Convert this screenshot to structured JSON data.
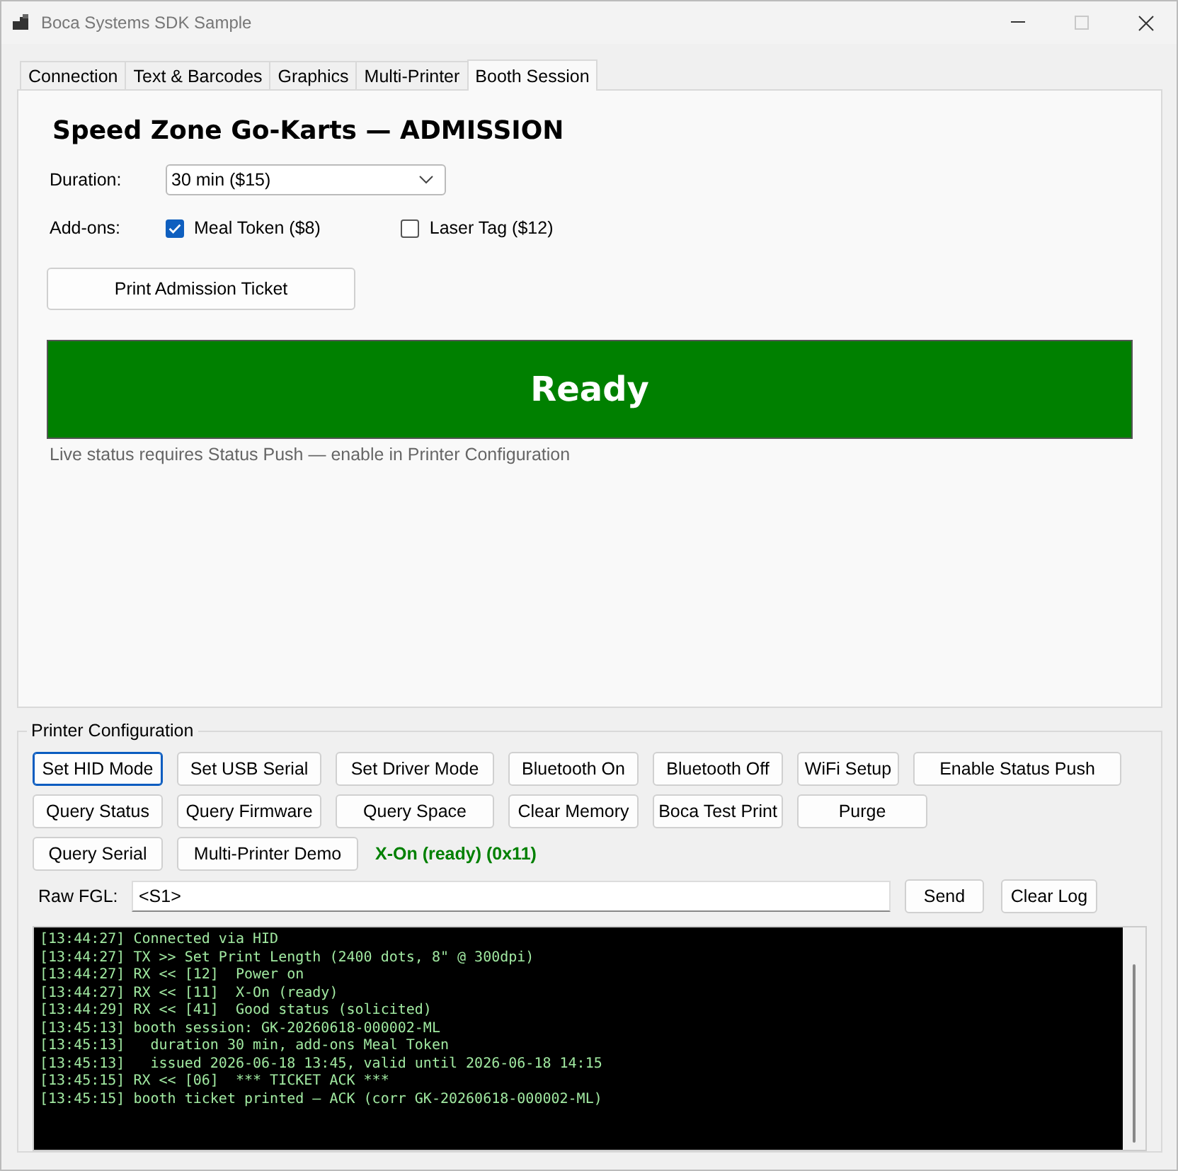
{
  "window": {
    "title": "Boca Systems SDK Sample",
    "maximize_disabled": true
  },
  "tabs": [
    {
      "label": "Connection",
      "selected": false
    },
    {
      "label": "Text & Barcodes",
      "selected": false
    },
    {
      "label": "Graphics",
      "selected": false
    },
    {
      "label": "Multi-Printer",
      "selected": false
    },
    {
      "label": "Booth Session",
      "selected": true
    }
  ],
  "booth": {
    "heading": "Speed Zone Go-Karts — ADMISSION",
    "duration": {
      "label": "Duration:",
      "value": "30 min ($15)"
    },
    "addons": {
      "label": "Add-ons:",
      "options": [
        {
          "label": "Meal Token ($8)",
          "checked": true
        },
        {
          "label": "Laser Tag ($12)",
          "checked": false
        }
      ]
    },
    "print_button": "Print Admission Ticket",
    "status": {
      "kind": "ready",
      "text": "Ready"
    },
    "note": "Live status requires Status Push — enable in Printer Configuration"
  },
  "config": {
    "title": "Printer Configuration",
    "button_rows": [
      [
        {
          "label": "Set HID Mode",
          "focused": true
        },
        {
          "label": "Set USB Serial",
          "focused": false
        },
        {
          "label": "Set Driver Mode",
          "focused": false
        },
        {
          "label": "Bluetooth On",
          "focused": false
        },
        {
          "label": "Bluetooth Off",
          "focused": false
        },
        {
          "label": "WiFi Setup",
          "focused": false
        },
        {
          "label": "Enable Status Push",
          "focused": false
        }
      ],
      [
        {
          "label": "Query Status",
          "focused": false
        },
        {
          "label": "Query Firmware",
          "focused": false
        },
        {
          "label": "Query Space",
          "focused": false
        },
        {
          "label": "Clear Memory",
          "focused": false
        },
        {
          "label": "Boca Test Print",
          "focused": false
        },
        {
          "label": "Purge",
          "focused": false
        }
      ],
      [
        {
          "label": "Query Serial",
          "focused": false
        },
        {
          "label": "Multi-Printer Demo",
          "focused": false
        }
      ]
    ],
    "printer_status": "X-On (ready) (0x11)",
    "raw_fgl": {
      "label": "Raw FGL:",
      "value": "<S1>"
    },
    "send_button": "Send",
    "clear_button": "Clear Log",
    "log": [
      "[13:44:27] Connected via HID",
      "[13:44:27] TX >> Set Print Length (2400 dots, 8\" @ 300dpi)",
      "[13:44:27] RX << [12]  Power on",
      "[13:44:27] RX << [11]  X-On (ready)",
      "[13:44:29] RX << [41]  Good status (solicited)",
      "[13:45:13] booth session: GK-20260618-000002-ML",
      "[13:45:13]   duration 30 min, add-ons Meal Token",
      "[13:45:13]   issued 2026-06-18 13:45, valid until 2026-06-18 14:15",
      "[13:45:15] RX << [06]  *** TICKET ACK ***",
      "[13:45:15] booth ticket printed — ACK (corr GK-20260618-000002-ML)"
    ]
  }
}
